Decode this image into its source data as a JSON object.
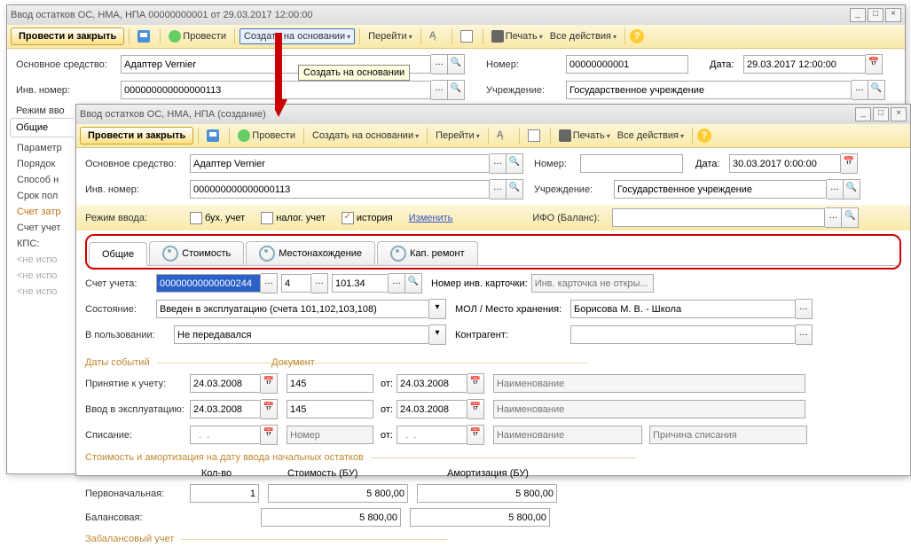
{
  "win1": {
    "title": "Ввод остатков ОС, НМА, НПА 00000000001 от 29.03.2017 12:00:00",
    "toolbar": {
      "post_close": "Провести и закрыть",
      "post": "Провести",
      "create_based": "Создать на основании",
      "goto": "Перейти",
      "print": "Печать",
      "all_actions": "Все действия"
    },
    "tooltip": "Создать на основании",
    "fields": {
      "basic_asset_lbl": "Основное средство:",
      "basic_asset": "Адаптер Vernier",
      "number_lbl": "Номер:",
      "number": "00000000001",
      "date_lbl": "Дата:",
      "date": "29.03.2017 12:00:00",
      "inv_lbl": "Инв. номер:",
      "inv": "000000000000000113",
      "inst_lbl": "Учреждение:",
      "inst": "Государственное учреждение",
      "mode_lbl": "Режим вво"
    },
    "left_tabs": {
      "t1": "Общие"
    },
    "left_list": {
      "i1": "Параметр",
      "i2": "Порядок",
      "i3": "Способ н",
      "i4": "Срок пол",
      "i5": "Счет затр",
      "i6": "Счет учет",
      "i7": "КПС:",
      "i8": "<не испо",
      "i9": "<не испо",
      "i10": "<не испо"
    }
  },
  "win2": {
    "title": "Ввод остатков ОС, НМА, НПА (создание)",
    "toolbar": {
      "post_close": "Провести и закрыть",
      "post": "Провести",
      "create_based": "Создать на основании",
      "goto": "Перейти",
      "print": "Печать",
      "all_actions": "Все действия"
    },
    "fields": {
      "basic_asset_lbl": "Основное средство:",
      "basic_asset": "Адаптер Vernier",
      "number_lbl": "Номер:",
      "number": "",
      "date_lbl": "Дата:",
      "date": "30.03.2017 0:00:00",
      "inv_lbl": "Инв. номер:",
      "inv": "000000000000000113",
      "inst_lbl": "Учреждение:",
      "inst": "Государственное учреждение",
      "mode_lbl": "Режим ввода:",
      "buh": "бух. учет",
      "nal": "налог. учет",
      "hist": "история",
      "change": "Изменить",
      "ifo_lbl": "ИФО (Баланс):",
      "tabs": {
        "t1": "Общие",
        "t2": "Стоимость",
        "t3": "Местонахождение",
        "t4": "Кап. ремонт"
      },
      "acct_lbl": "Счет учета:",
      "acct1": "00000000000000244",
      "acct2": "4",
      "acct3": "101.34",
      "card_lbl": "Номер инв. карточки:",
      "card_ph": "Инв. карточка не откры...",
      "state_lbl": "Состояние:",
      "state": "Введен в эксплуатацию (счета 101,102,103,108)",
      "mol_lbl": "МОЛ / Место хранения:",
      "mol": "Борисова М. В. - Школа",
      "use_lbl": "В пользовании:",
      "use": "Не передавался",
      "contr_lbl": "Контрагент:",
      "dates_group": "Даты событий",
      "doc_group": "Документ",
      "accept_lbl": "Принятие к учету:",
      "accept_date": "24.03.2008",
      "accept_num": "145",
      "ot": "от:",
      "accept_from": "24.03.2008",
      "name_ph": "Наименование",
      "oper_lbl": "Ввод в эксплуатацию:",
      "oper_date": "24.03.2008",
      "oper_num": "145",
      "oper_from": "24.03.2008",
      "write_lbl": "Списание:",
      "num_ph": "Номер",
      "reason_ph": "Причина списания",
      "cost_group": "Стоимость и амортизация на дату ввода начальных остатков",
      "qty_lbl": "Кол-во",
      "cost_bu_lbl": "Стоимость (БУ)",
      "amort_bu_lbl": "Амортизация (БУ)",
      "first_lbl": "Первоначальная:",
      "qty1": "1",
      "cost1": "5 800,00",
      "amort1": "5 800,00",
      "bal_lbl": "Балансовая:",
      "cost2": "5 800,00",
      "amort2": "5 800,00",
      "offbal_lbl": "Забалансовый учет"
    }
  }
}
